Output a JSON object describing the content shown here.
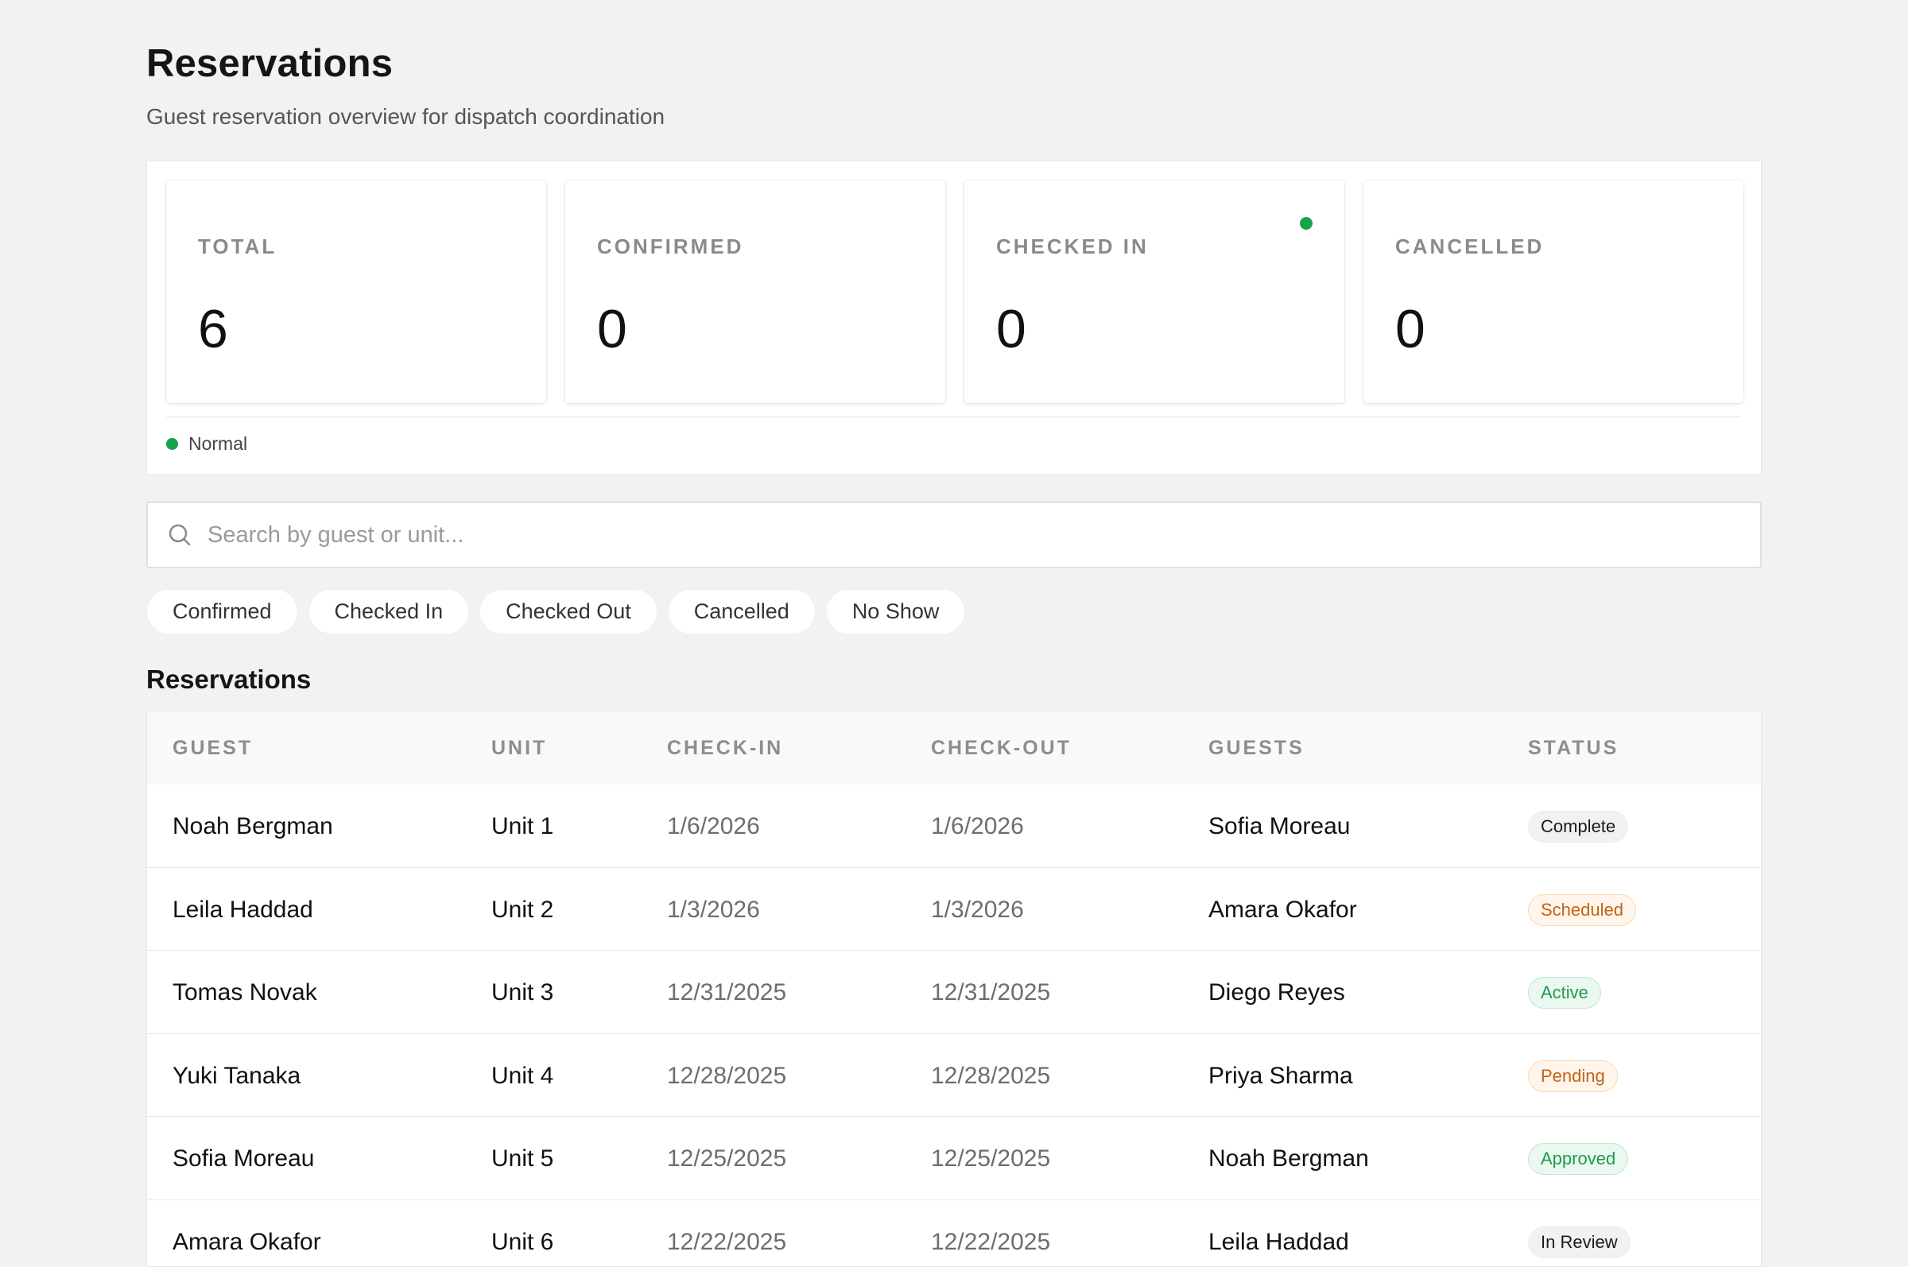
{
  "page": {
    "title": "Reservations",
    "subtitle": "Guest reservation overview for dispatch coordination"
  },
  "stats": [
    {
      "label": "TOTAL",
      "value": "6"
    },
    {
      "label": "CONFIRMED",
      "value": "0"
    },
    {
      "label": "CHECKED IN",
      "value": "0",
      "indicator_color": "#16a34a"
    },
    {
      "label": "CANCELLED",
      "value": "0"
    }
  ],
  "system_status": {
    "label": "Normal",
    "color": "#16a34a"
  },
  "search": {
    "placeholder": "Search by guest or unit...",
    "value": "",
    "icon": "search-icon"
  },
  "filters": [
    "Confirmed",
    "Checked In",
    "Checked Out",
    "Cancelled",
    "No Show"
  ],
  "table": {
    "title": "Reservations",
    "columns": [
      "GUEST",
      "UNIT",
      "CHECK-IN",
      "CHECK-OUT",
      "GUESTS",
      "STATUS"
    ],
    "rows": [
      {
        "guest": "Noah Bergman",
        "unit": "Unit 1",
        "check_in": "1/6/2026",
        "check_out": "1/6/2026",
        "guests": "Sofia Moreau",
        "status": "Complete",
        "status_tone": "grey"
      },
      {
        "guest": "Leila Haddad",
        "unit": "Unit 2",
        "check_in": "1/3/2026",
        "check_out": "1/3/2026",
        "guests": "Amara Okafor",
        "status": "Scheduled",
        "status_tone": "orange"
      },
      {
        "guest": "Tomas Novak",
        "unit": "Unit 3",
        "check_in": "12/31/2025",
        "check_out": "12/31/2025",
        "guests": "Diego Reyes",
        "status": "Active",
        "status_tone": "green"
      },
      {
        "guest": "Yuki Tanaka",
        "unit": "Unit 4",
        "check_in": "12/28/2025",
        "check_out": "12/28/2025",
        "guests": "Priya Sharma",
        "status": "Pending",
        "status_tone": "orange"
      },
      {
        "guest": "Sofia Moreau",
        "unit": "Unit 5",
        "check_in": "12/25/2025",
        "check_out": "12/25/2025",
        "guests": "Noah Bergman",
        "status": "Approved",
        "status_tone": "green"
      },
      {
        "guest": "Amara Okafor",
        "unit": "Unit 6",
        "check_in": "12/22/2025",
        "check_out": "12/22/2025",
        "guests": "Leila Haddad",
        "status": "In Review",
        "status_tone": "grey"
      }
    ]
  }
}
